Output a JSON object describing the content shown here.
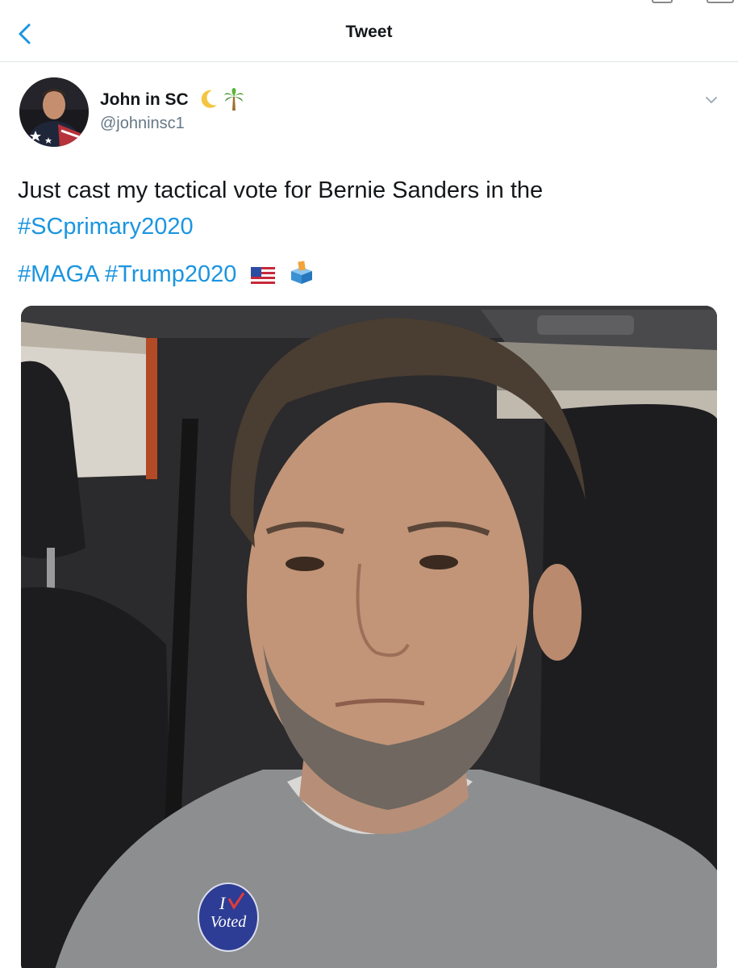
{
  "header": {
    "title": "Tweet"
  },
  "author": {
    "name": "John in SC",
    "name_emojis": [
      "crescent-moon",
      "palm-tree"
    ],
    "handle": "@johninsc1"
  },
  "tweet": {
    "line1": "Just cast my tactical vote for Bernie Sanders in the",
    "hashtag1": "#SCprimary2020",
    "hashtag2": "#MAGA",
    "hashtag3": "#Trump2020",
    "trailing_emojis": [
      "us-flag",
      "ballot-box"
    ]
  },
  "photo": {
    "description_icon": "selfie-photo",
    "sticker_text_line1": "I",
    "sticker_text_line2": "Voted"
  },
  "colors": {
    "link": "#1b95e0",
    "text": "#14171a",
    "secondary": "#657786",
    "divider": "#dfe3e7"
  }
}
